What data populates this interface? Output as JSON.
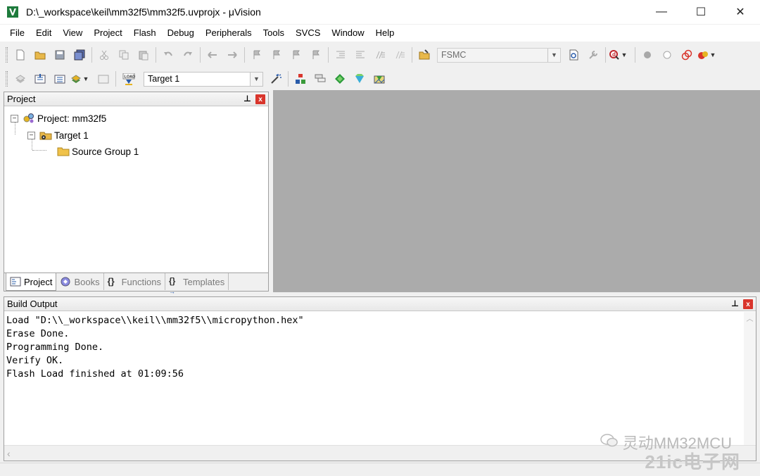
{
  "window": {
    "title": "D:\\_workspace\\keil\\mm32f5\\mm32f5.uvprojx - μVision",
    "minimize": "—",
    "maximize": "☐",
    "close": "✕"
  },
  "menu": [
    "File",
    "Edit",
    "View",
    "Project",
    "Flash",
    "Debug",
    "Peripherals",
    "Tools",
    "SVCS",
    "Window",
    "Help"
  ],
  "toolbar": {
    "find_combo": "FSMC",
    "target_combo": "Target 1",
    "load_label": "LOAD"
  },
  "project_panel": {
    "title": "Project",
    "pin": "ᵗ",
    "close": "x",
    "tree": {
      "root": "Project: mm32f5",
      "target": "Target 1",
      "group": "Source Group 1"
    },
    "tabs": [
      "Project",
      "Books",
      "Functions",
      "Templates"
    ]
  },
  "build_output": {
    "title": "Build Output",
    "lines": [
      "Load \"D:\\\\_workspace\\\\keil\\\\mm32f5\\\\micropython.hex\"",
      "Erase Done.",
      "Programming Done.",
      "Verify OK.",
      "Flash Load finished at 01:09:56"
    ]
  },
  "watermark": {
    "text": "灵动MM32MCU",
    "sub": "21ic电子网"
  },
  "colors": {
    "accent_red": "#d9352c",
    "editor_bg": "#ababab",
    "keil_green": "#2e8b57"
  }
}
